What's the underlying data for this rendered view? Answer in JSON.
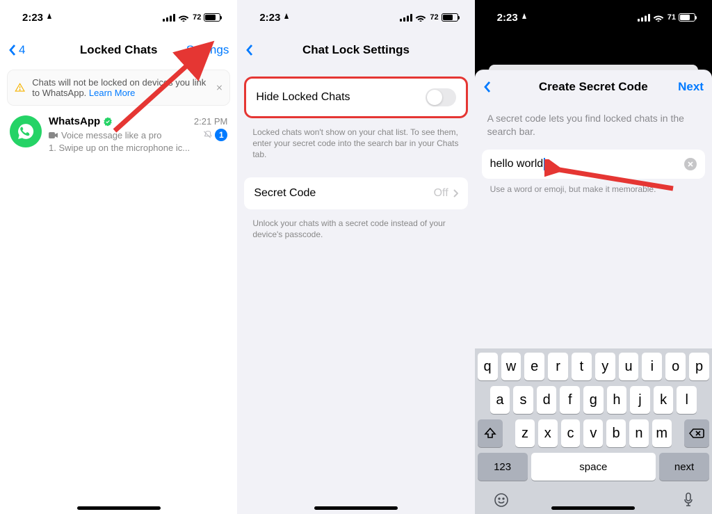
{
  "status": {
    "time": "2:23",
    "battery_pct_1": "72",
    "battery_pct_2": "72",
    "battery_pct_3": "71"
  },
  "panel1": {
    "back_count": "4",
    "title": "Locked Chats",
    "settings": "Settings",
    "alert_text": "Chats will not be locked on devices you link to WhatsApp. ",
    "alert_link": "Learn More",
    "chat": {
      "name": "WhatsApp",
      "time": "2:21 PM",
      "line1": "Voice message like a pro",
      "line2": "1. Swipe up on the microphone ic...",
      "badge": "1"
    }
  },
  "panel2": {
    "title": "Chat Lock Settings",
    "hide_label": "Hide Locked Chats",
    "hide_note": "Locked chats won't show on your chat list. To see them, enter your secret code into the search bar in your Chats tab.",
    "secret_label": "Secret Code",
    "secret_value": "Off",
    "secret_note": "Unlock your chats with a secret code instead of your device's passcode."
  },
  "panel3": {
    "title": "Create Secret Code",
    "next": "Next",
    "desc": "A secret code lets you find locked chats in the search bar.",
    "input_value": "hello world",
    "hint": "Use a word or emoji, but make it memorable."
  },
  "keyboard": {
    "row1": [
      "q",
      "w",
      "e",
      "r",
      "t",
      "y",
      "u",
      "i",
      "o",
      "p"
    ],
    "row2": [
      "a",
      "s",
      "d",
      "f",
      "g",
      "h",
      "j",
      "k",
      "l"
    ],
    "row3": [
      "z",
      "x",
      "c",
      "v",
      "b",
      "n",
      "m"
    ],
    "k123": "123",
    "space": "space",
    "next": "next"
  }
}
